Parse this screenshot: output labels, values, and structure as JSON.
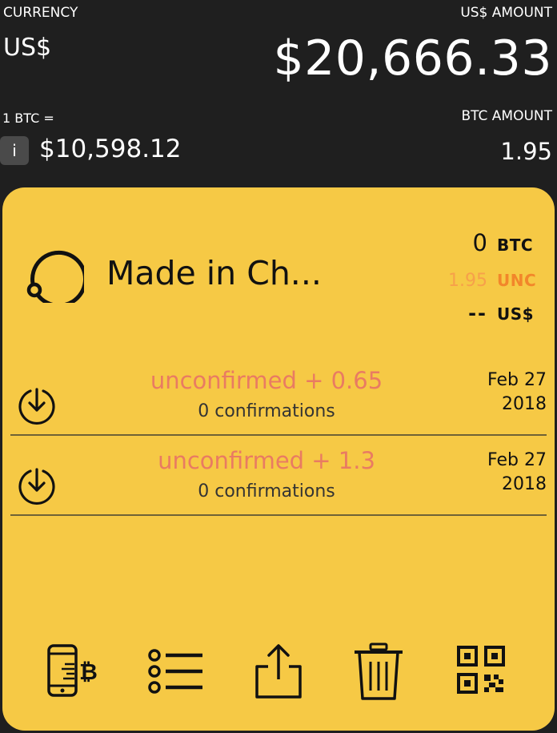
{
  "header": {
    "currency_label": "CURRENCY",
    "currency_value": "US$",
    "usd_amount_label": "US$ AMOUNT",
    "usd_amount_value": "$20,666.33",
    "rate_label": "1 BTC =",
    "info_badge": "i",
    "rate_value": "$10,598.12",
    "btc_amount_label": "BTC AMOUNT",
    "btc_amount_value": "1.95"
  },
  "wallet": {
    "icon": "wallet-ring-icon",
    "name": "Made in Ch...",
    "balances": {
      "btc_value": "0",
      "btc_unit": "BTC",
      "unc_value": "1.95",
      "unc_unit": "UNC",
      "usd_value": "--",
      "usd_unit": "US$"
    }
  },
  "transactions": [
    {
      "icon": "receive-arrow-icon",
      "status": "unconfirmed + 0.65",
      "confirmations": "0 confirmations",
      "date_line1": "Feb 27",
      "date_line2": "2018"
    },
    {
      "icon": "receive-arrow-icon",
      "status": "unconfirmed + 1.3",
      "confirmations": "0 confirmations",
      "date_line1": "Feb 27",
      "date_line2": "2018"
    }
  ],
  "toolbar": {
    "send_icon": "phone-bitcoin-icon",
    "list_icon": "list-icon",
    "share_icon": "share-icon",
    "delete_icon": "trash-icon",
    "qr_icon": "qr-code-icon"
  },
  "colors": {
    "background": "#1f1f1f",
    "card": "#f6c945",
    "unconfirmed": "#e97b62",
    "unc_accent": "#f2862a"
  }
}
